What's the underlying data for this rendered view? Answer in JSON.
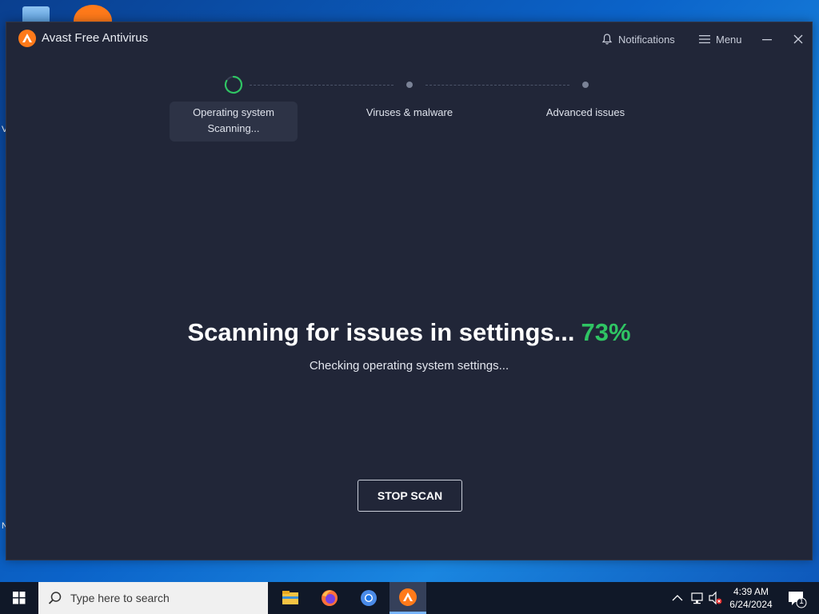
{
  "desktop": {
    "edge_letters": [
      "V",
      "N"
    ]
  },
  "app": {
    "title": "Avast Free Antivirus",
    "notifications_label": "Notifications",
    "menu_label": "Menu",
    "brand_color": "#ff7a1a",
    "accent_color": "#2fc463"
  },
  "steps": [
    {
      "label": "Operating system",
      "status": "Scanning...",
      "state": "active"
    },
    {
      "label": "Viruses & malware",
      "state": "pending"
    },
    {
      "label": "Advanced issues",
      "state": "pending"
    }
  ],
  "scan": {
    "heading": "Scanning for issues in settings...",
    "percent": "73%",
    "progress": 0.73,
    "subtext": "Checking operating system settings...",
    "stop_label": "STOP SCAN"
  },
  "taskbar": {
    "search_placeholder": "Type here to search",
    "pinned": [
      "file-explorer-icon",
      "firefox-icon",
      "chrome-icon",
      "avast-icon"
    ],
    "time": "4:39 AM",
    "date": "6/24/2024",
    "notification_count": "1"
  }
}
